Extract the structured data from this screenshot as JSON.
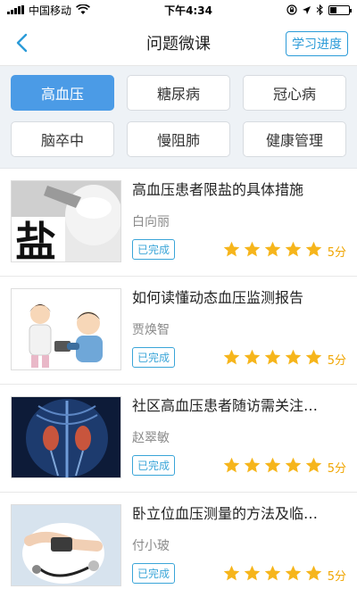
{
  "status": {
    "carrier": "中国移动",
    "time": "下午4:34"
  },
  "header": {
    "title": "问题微课",
    "progress_label": "学习进度"
  },
  "categories": [
    {
      "label": "高血压",
      "active": true
    },
    {
      "label": "糖尿病",
      "active": false
    },
    {
      "label": "冠心病",
      "active": false
    },
    {
      "label": "脑卒中",
      "active": false
    },
    {
      "label": "慢阻肺",
      "active": false
    },
    {
      "label": "健康管理",
      "active": false
    }
  ],
  "courses": [
    {
      "title": "高血压患者限盐的具体措施",
      "teacher": "白向丽",
      "status": "已完成",
      "stars": 5,
      "score": "5分",
      "thumb_text": "盐"
    },
    {
      "title": "如何读懂动态血压监测报告",
      "teacher": "贾焕智",
      "status": "已完成",
      "stars": 5,
      "score": "5分"
    },
    {
      "title": "社区高血压患者随访需关注…",
      "teacher": "赵翠敏",
      "status": "已完成",
      "stars": 5,
      "score": "5分"
    },
    {
      "title": "卧立位血压测量的方法及临…",
      "teacher": "付小玻",
      "status": "已完成",
      "stars": 5,
      "score": "5分"
    }
  ],
  "colors": {
    "accent": "#4b9be6",
    "badge": "#3aa5d8",
    "star": "#f6b51b"
  }
}
